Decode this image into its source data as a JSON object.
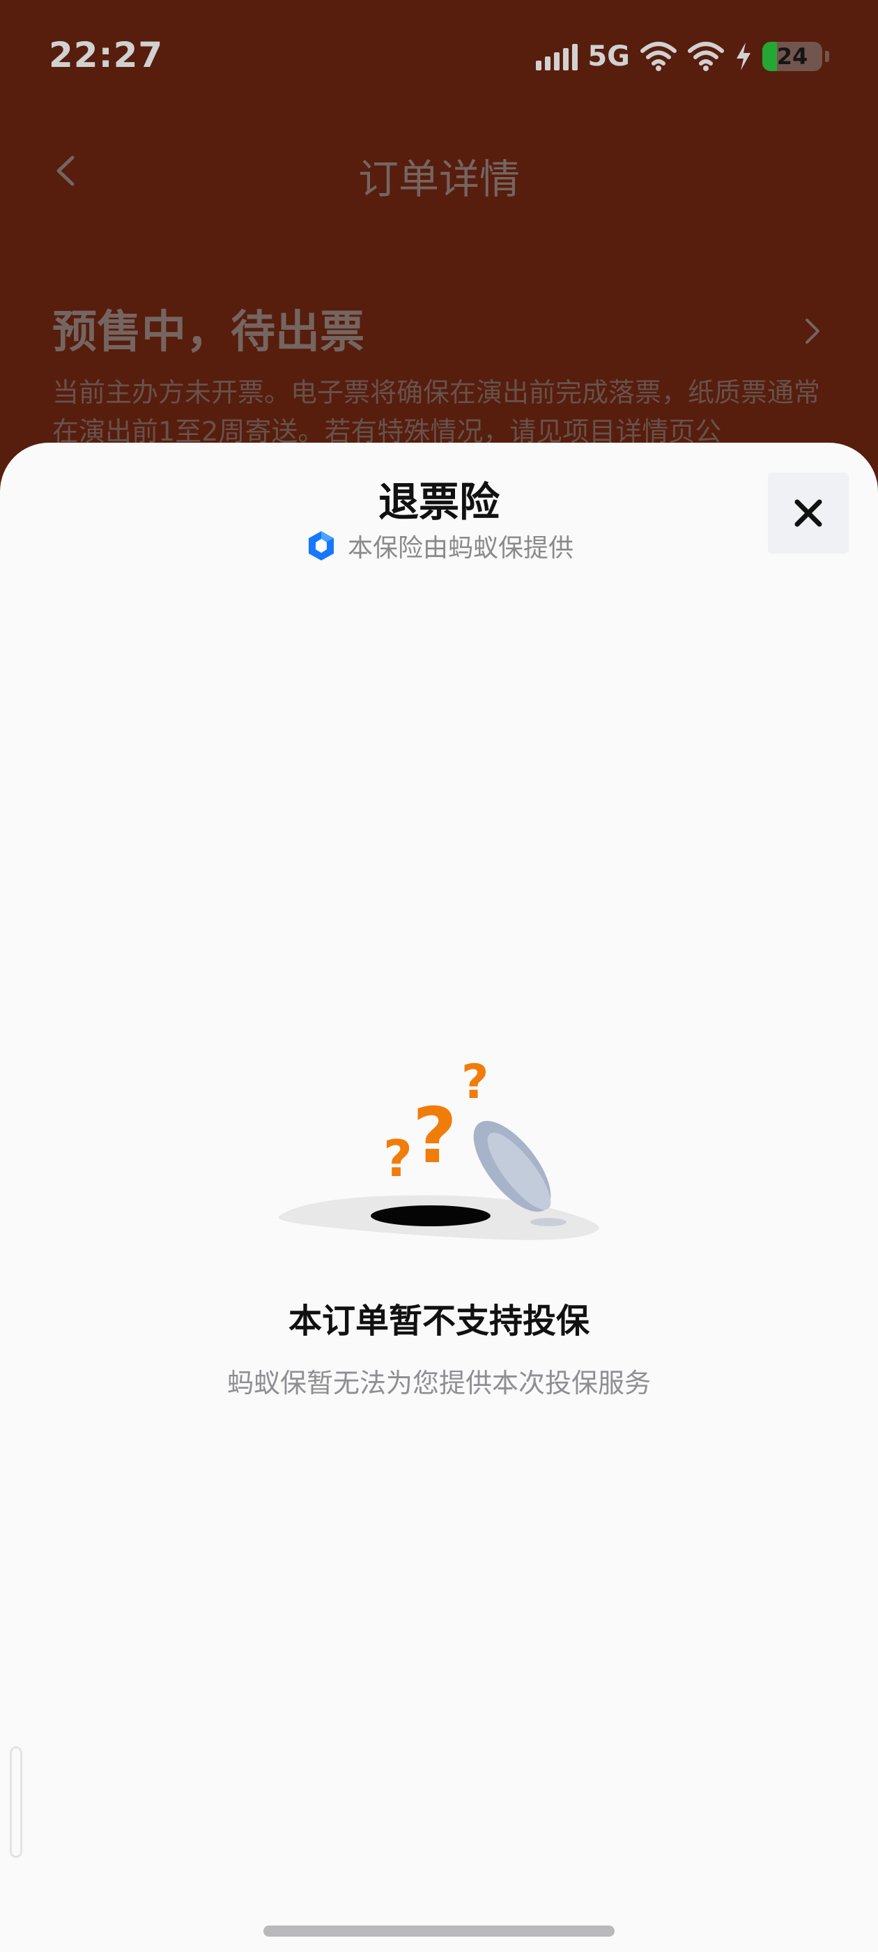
{
  "status_bar": {
    "time": "22:27",
    "network": "5G",
    "battery": "24",
    "battery_level": 0.24,
    "icons": [
      "signal-icon",
      "wifi-icon",
      "wifi-icon",
      "charging-icon",
      "battery-icon"
    ]
  },
  "nav": {
    "title": "订单详情",
    "back_icon": "chevron-left-icon"
  },
  "order": {
    "status": "预售中，待出票",
    "description": "当前主办方未开票。电子票将确保在演出前完成落票，纸质票通常在演出前1至2周寄送。若有特殊情况，请见项目详情页公"
  },
  "sheet": {
    "title": "退票险",
    "provider": "本保险由蚂蚁保提供",
    "provider_icon": "ant-insurance-logo-icon",
    "close_icon": "close-icon",
    "empty_title": "本订单暂不支持投保",
    "empty_subtitle": "蚂蚁保暂无法为您提供本次投保服务"
  },
  "colors": {
    "header_bg": "#6b2410",
    "sheet_bg": "#fafafa",
    "accent_orange": "#f07d0a",
    "logo_blue": "#1677ff"
  }
}
